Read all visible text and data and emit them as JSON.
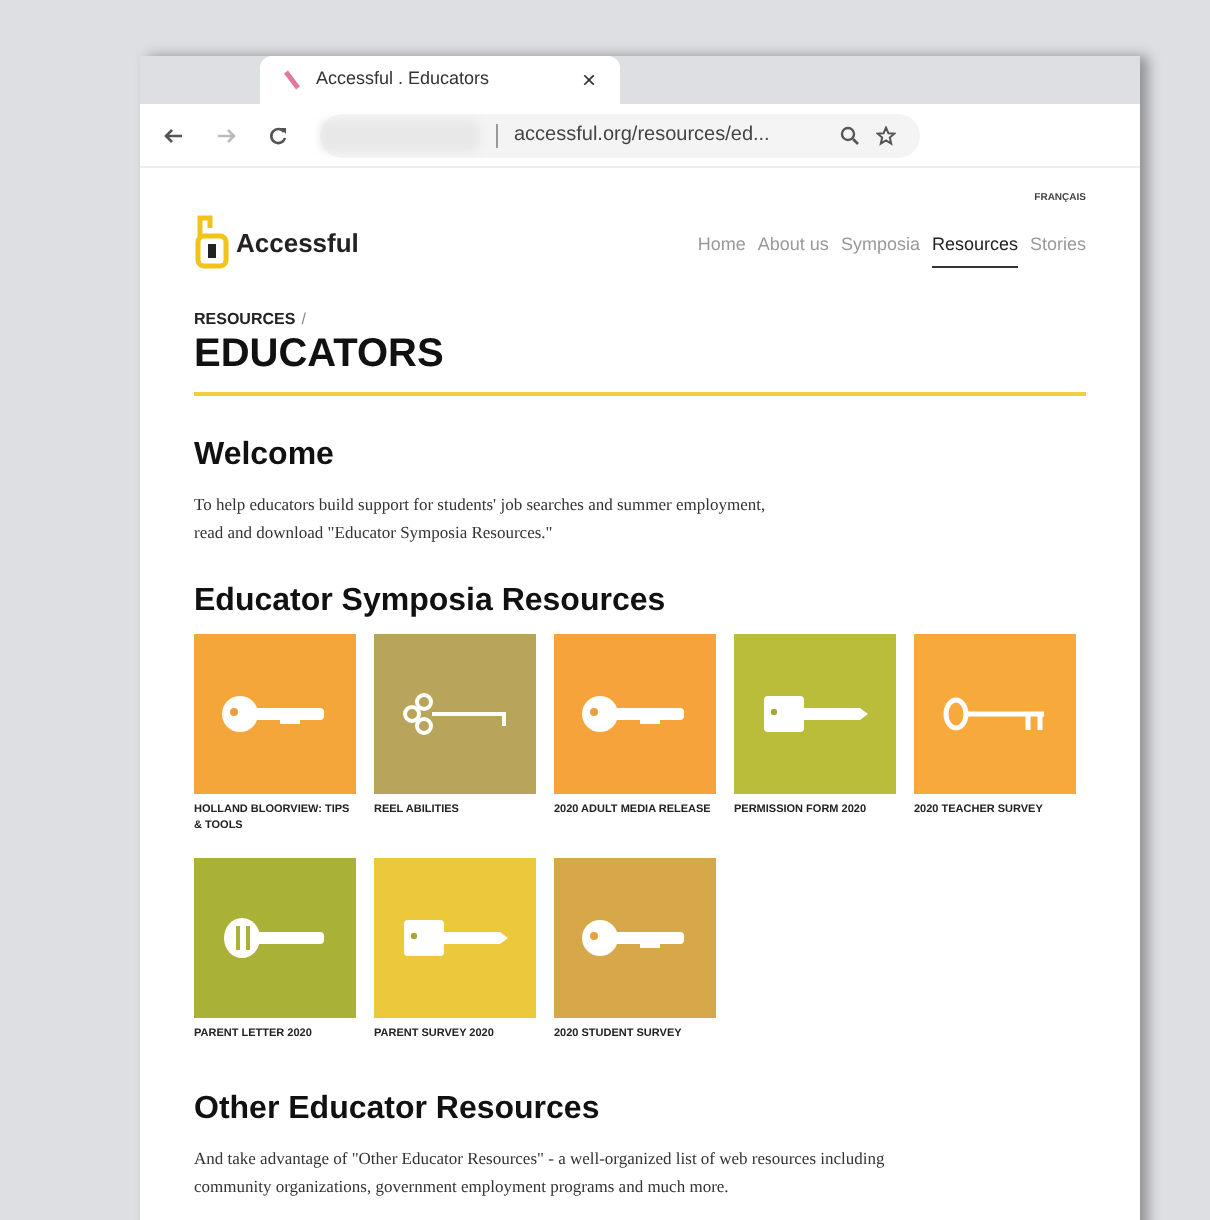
{
  "browser": {
    "tab_title": "Accessful . Educators",
    "tab_close": "×",
    "url": "accessful.org/resources/ed..."
  },
  "site": {
    "logo": "Accessful",
    "language": "FRANÇAIS",
    "nav": [
      {
        "label": "Home",
        "selected": false
      },
      {
        "label": "About us",
        "selected": false
      },
      {
        "label": "Symposia",
        "selected": false
      },
      {
        "label": "Resources",
        "selected": true
      },
      {
        "label": "Stories",
        "selected": false
      }
    ]
  },
  "breadcrumb": {
    "parent": "RESOURCES",
    "separator": "/",
    "title": "EDUCATORS"
  },
  "welcome": {
    "heading": "Welcome",
    "text": "To help educators build support for students' job searches and summer employment, read and download \"Educator Symposia Resources.\""
  },
  "symposia": {
    "heading": "Educator Symposia Resources",
    "tiles": [
      {
        "label": "HOLLAND BLOORVIEW: TIPS & TOOLS",
        "color": "#f5a63a",
        "kind": "round"
      },
      {
        "label": "REEL ABILITIES",
        "color": "#b8a45a",
        "kind": "ornate"
      },
      {
        "label": "2020 ADULT MEDIA RELEASE",
        "color": "#f5a33a",
        "kind": "round"
      },
      {
        "label": "PERMISSION FORM 2020",
        "color": "#b9bd3a",
        "kind": "flat"
      },
      {
        "label": "2020 TEACHER SURVEY",
        "color": "#f7a93b",
        "kind": "skeleton"
      },
      {
        "label": "PARENT LETTER 2020",
        "color": "#a9b136",
        "kind": "grip"
      },
      {
        "label": "PARENT SURVEY 2020",
        "color": "#ecc93a",
        "kind": "flat"
      },
      {
        "label": "2020 STUDENT SURVEY",
        "color": "#d7a84a",
        "kind": "round"
      }
    ]
  },
  "other": {
    "heading": "Other Educator Resources",
    "text": "And take advantage of \"Other Educator Resources\" - a well-organized list of web resources including community organizations, government employment programs and much more."
  }
}
